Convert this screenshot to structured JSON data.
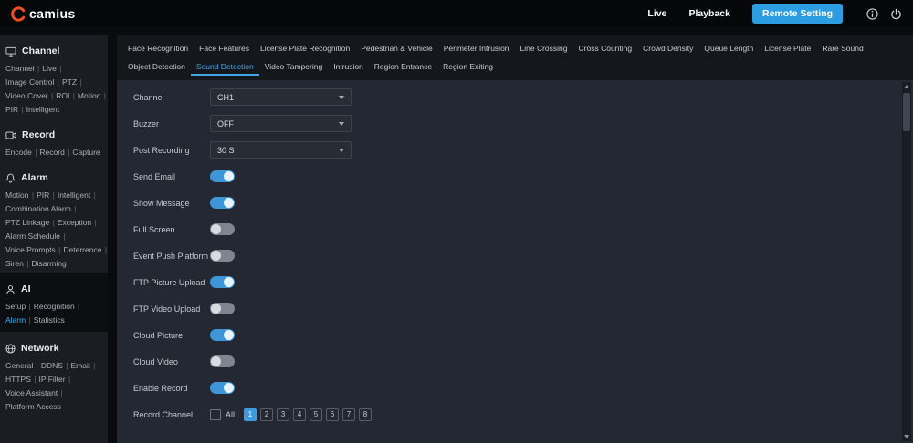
{
  "topbar": {
    "logo_text": "camius",
    "nav": [
      {
        "label": "Live"
      },
      {
        "label": "Playback"
      },
      {
        "label": "Remote Setting",
        "active": true
      }
    ]
  },
  "sidebar": {
    "sections": [
      {
        "title": "Channel",
        "lines": [
          [
            "Channel",
            "Live"
          ],
          [
            "Image Control",
            "PTZ"
          ],
          [
            "Video Cover",
            "ROI",
            "Motion"
          ],
          [
            "PIR",
            "Intelligent"
          ]
        ]
      },
      {
        "title": "Record",
        "lines": [
          [
            "Encode",
            "Record",
            "Capture"
          ]
        ]
      },
      {
        "title": "Alarm",
        "lines": [
          [
            "Motion",
            "PIR",
            "Intelligent"
          ],
          [
            "Combination Alarm"
          ],
          [
            "PTZ Linkage",
            "Exception"
          ],
          [
            "Alarm Schedule"
          ],
          [
            "Voice Prompts",
            "Deterrence"
          ],
          [
            "Siren",
            "Disarming"
          ]
        ]
      },
      {
        "title": "AI",
        "active_link": "Alarm",
        "lines": [
          [
            "Setup",
            "Recognition"
          ],
          [
            "Alarm",
            "Statistics"
          ]
        ]
      },
      {
        "title": "Network",
        "lines": [
          [
            "General",
            "DDNS",
            "Email"
          ],
          [
            "HTTPS",
            "IP Filter"
          ],
          [
            "Voice Assistant"
          ],
          [
            "Platform Access"
          ]
        ]
      }
    ]
  },
  "tabs": {
    "row1": [
      "Face Recognition",
      "Face Features",
      "License Plate Recognition",
      "Pedestrian & Vehicle",
      "Perimeter Intrusion",
      "Line Crossing",
      "Cross Counting",
      "Crowd Density",
      "Queue Length",
      "License Plate",
      "Rare Sound"
    ],
    "row2": [
      "Object Detection",
      "Sound Detection",
      "Video Tampering",
      "Intrusion",
      "Region Entrance",
      "Region Exiting"
    ],
    "active": "Sound Detection"
  },
  "form": {
    "selects": [
      {
        "label": "Channel",
        "value": "CH1"
      },
      {
        "label": "Buzzer",
        "value": "OFF"
      },
      {
        "label": "Post Recording",
        "value": "30 S"
      }
    ],
    "toggles": [
      {
        "label": "Send Email",
        "on": true
      },
      {
        "label": "Show Message",
        "on": true
      },
      {
        "label": "Full Screen",
        "on": false
      },
      {
        "label": "Event Push Platform",
        "on": false
      },
      {
        "label": "FTP Picture Upload",
        "on": true
      },
      {
        "label": "FTP Video Upload",
        "on": false
      },
      {
        "label": "Cloud Picture",
        "on": true
      },
      {
        "label": "Cloud Video",
        "on": false
      },
      {
        "label": "Enable Record",
        "on": true
      }
    ],
    "record_channel": {
      "label": "Record Channel",
      "all_label": "All",
      "channels": [
        "1",
        "2",
        "3",
        "4",
        "5",
        "6",
        "7",
        "8"
      ],
      "selected": "1"
    }
  },
  "icons": {
    "logo": "c-arc",
    "channel": "monitor",
    "record": "video-camera",
    "alarm": "bell",
    "ai": "person",
    "network": "globe",
    "info": "circled-i",
    "power": "power-symbol",
    "select_caret": "chevron-down",
    "scrollbar": "up-down-arrows"
  },
  "colors": {
    "accent": "#2f9fe4",
    "toggle_on": "#3e96d8",
    "topbar_bg": "#060708",
    "sidebar_bg": "#1a1d22",
    "panel_bg": "#232832"
  }
}
